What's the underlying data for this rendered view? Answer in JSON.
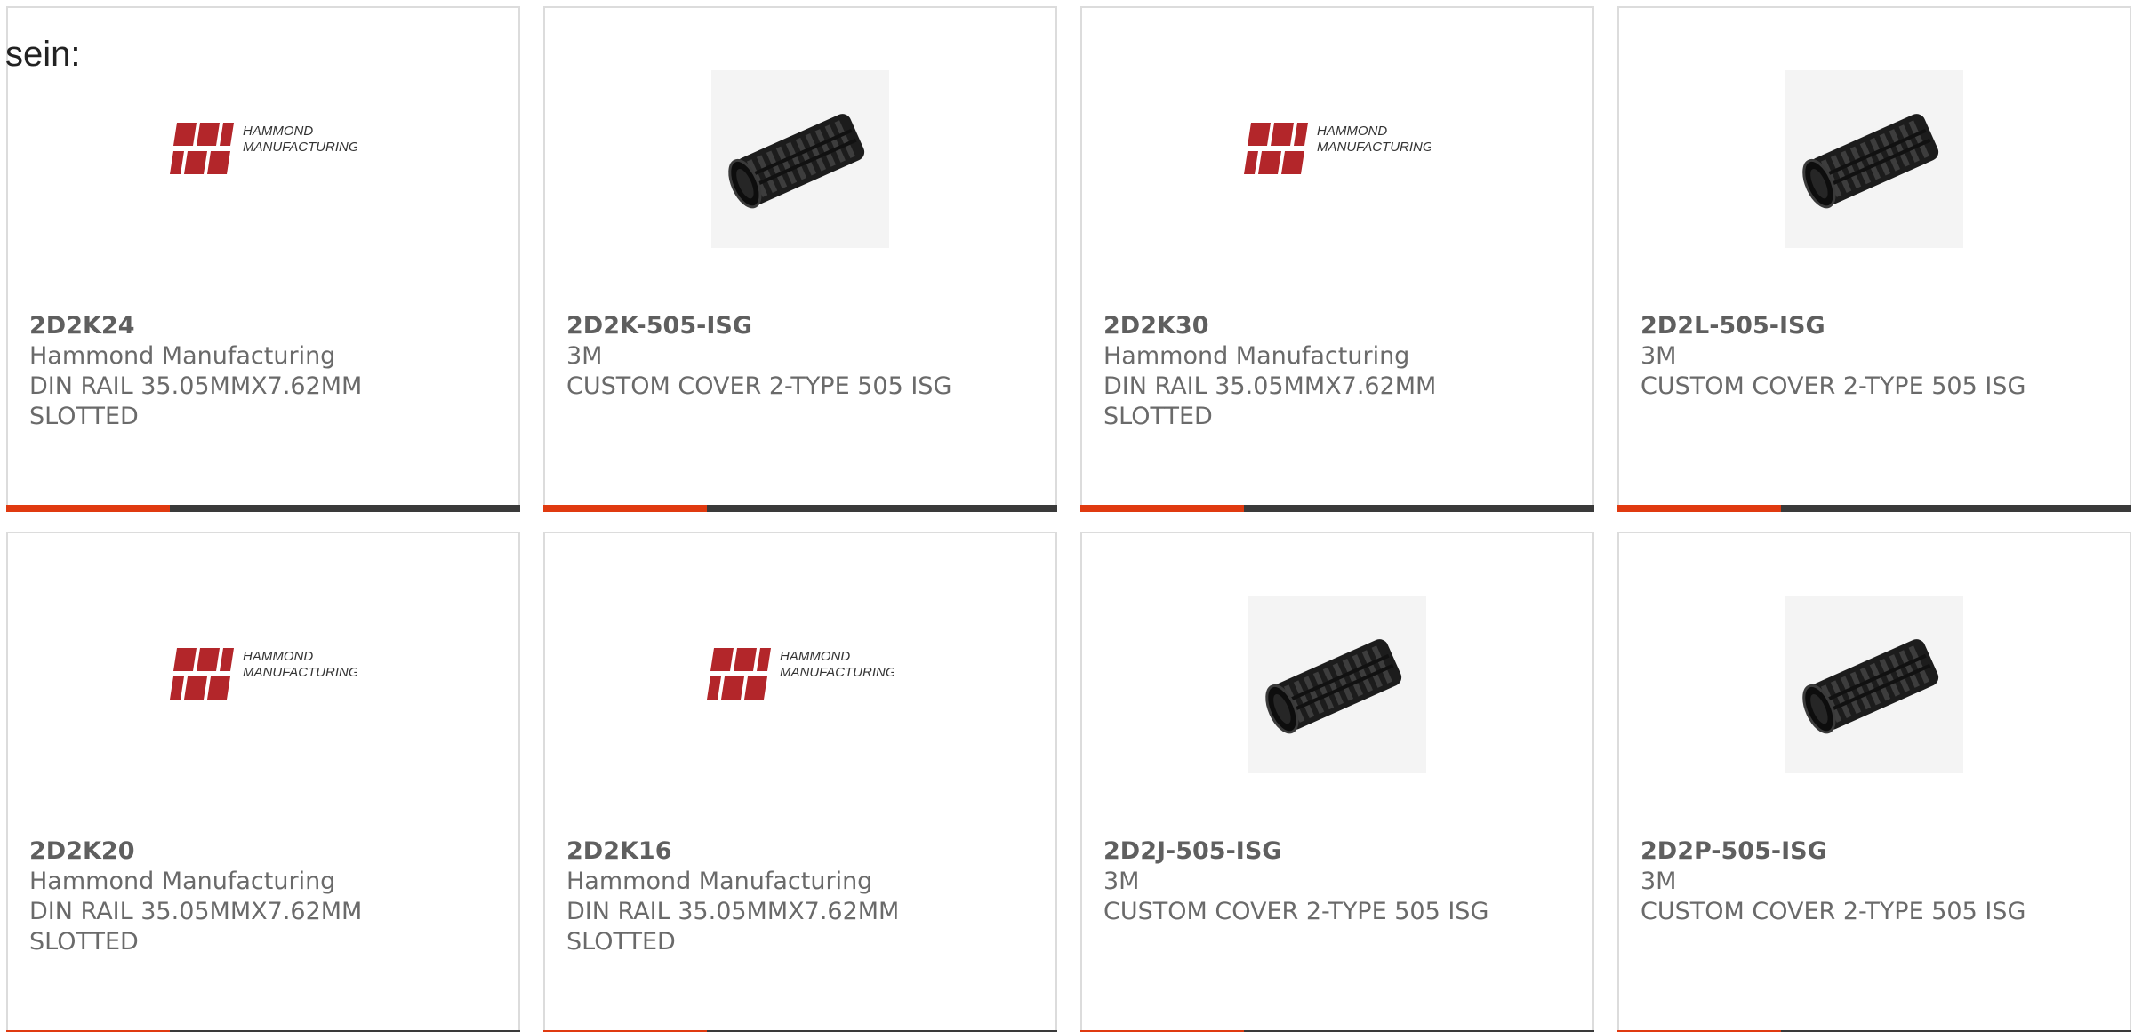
{
  "intro_text": "sein:",
  "colors": {
    "accent": "#e03a10",
    "bar": "#3a3a3a",
    "border": "#dcdcdc",
    "text": "#6a6a6a",
    "logo_red": "#b3262a"
  },
  "logo_words": {
    "line1": "HAMMOND",
    "line2": "MANUFACTURING."
  },
  "products": [
    {
      "part_number": "2D2K24",
      "manufacturer": "Hammond Manufacturing",
      "description_1": "DIN RAIL 35.05MMX7.62MM",
      "description_2": "SLOTTED",
      "image": "hammond-logo"
    },
    {
      "part_number": "2D2K-505-ISG",
      "manufacturer": "3M",
      "description_1": "CUSTOM COVER 2-TYPE 505 ISG",
      "description_2": "",
      "image": "black-slotted-tube"
    },
    {
      "part_number": "2D2K30",
      "manufacturer": "Hammond Manufacturing",
      "description_1": "DIN RAIL 35.05MMX7.62MM",
      "description_2": "SLOTTED",
      "image": "hammond-logo"
    },
    {
      "part_number": "2D2L-505-ISG",
      "manufacturer": "3M",
      "description_1": "CUSTOM COVER 2-TYPE 505 ISG",
      "description_2": "",
      "image": "black-slotted-tube"
    },
    {
      "part_number": "2D2K20",
      "manufacturer": "Hammond Manufacturing",
      "description_1": "DIN RAIL 35.05MMX7.62MM",
      "description_2": "SLOTTED",
      "image": "hammond-logo"
    },
    {
      "part_number": "2D2K16",
      "manufacturer": "Hammond Manufacturing",
      "description_1": "DIN RAIL 35.05MMX7.62MM",
      "description_2": "SLOTTED",
      "image": "hammond-logo"
    },
    {
      "part_number": "2D2J-505-ISG",
      "manufacturer": "3M",
      "description_1": "CUSTOM COVER 2-TYPE 505 ISG",
      "description_2": "",
      "image": "black-slotted-tube"
    },
    {
      "part_number": "2D2P-505-ISG",
      "manufacturer": "3M",
      "description_1": "CUSTOM COVER 2-TYPE 505 ISG",
      "description_2": "",
      "image": "black-slotted-tube"
    }
  ]
}
